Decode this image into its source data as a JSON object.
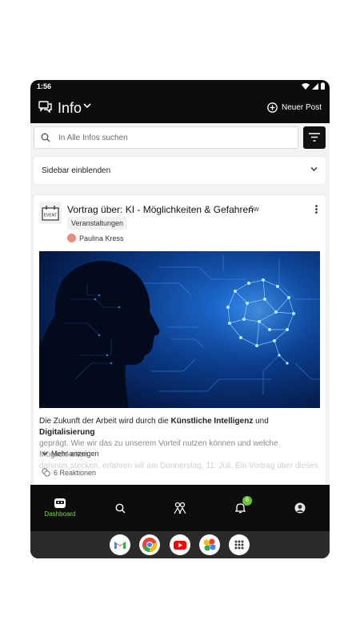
{
  "status_bar": {
    "time": "1:56"
  },
  "app_bar": {
    "title": "Info",
    "new_post_label": "Neuer Post"
  },
  "search": {
    "placeholder": "In Alle Infos suchen"
  },
  "sidebar_toggle": {
    "label": "Sidebar einblenden"
  },
  "post": {
    "title": "Vortrag über: KI - Möglichkeiten & Gefahren",
    "age": "5w",
    "tag": "Veranstaltungen",
    "author": "Paulina Kress",
    "event_icon_text": "EVENT",
    "body_prefix": "Die Zukunft der Arbeit wird durch die ",
    "body_bold_1": "Künstliche Intelligenz",
    "body_mid": " und ",
    "body_bold_2": "Digitalisierung",
    "body_line_2": "geprägt. Wie wir das zu unserem Vorteil nutzen können und welche Möglichkeiten",
    "body_line_3": "dahinter stecken, erfahren wir am Donnerstag, 11. Juli. Ein Vortrag über dieses",
    "show_more_label": "Mehr anzeigen",
    "reactions_label": "6 Reaktionen"
  },
  "bottom_nav": {
    "dashboard_label": "Dashboard",
    "notifications_badge": "6"
  },
  "colors": {
    "accent_green": "#7bd14b",
    "dark_bg": "#0d0d0d",
    "content_bg": "#f4f3f1"
  },
  "icons": {
    "app_bar": [
      "chat-icon",
      "chevron-down-icon",
      "plus-circle-icon"
    ],
    "bottom_nav": [
      "dashboard-icon",
      "search-icon",
      "people-icon",
      "bell-icon",
      "profile-icon"
    ],
    "dock": [
      "gmail-icon",
      "chrome-icon",
      "youtube-icon",
      "photos-icon",
      "app-drawer-icon"
    ]
  }
}
